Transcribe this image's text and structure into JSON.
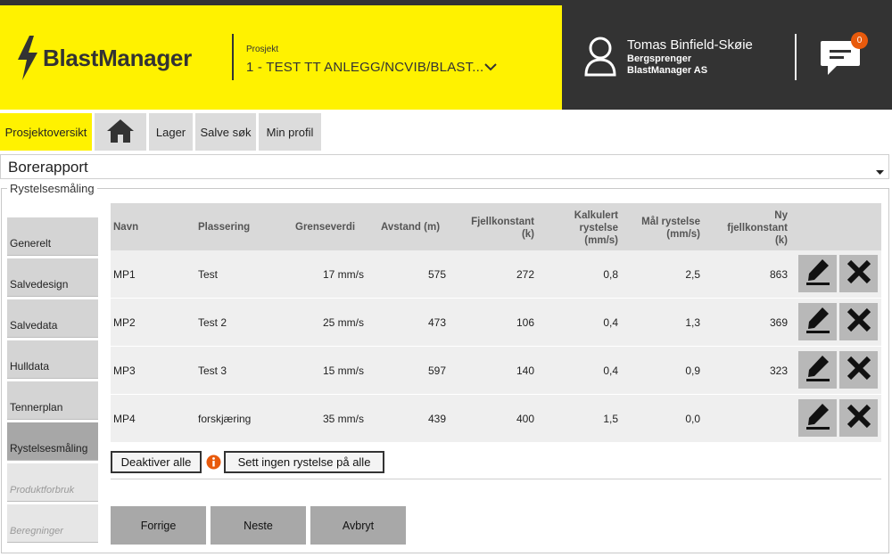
{
  "header": {
    "logo_text": "BlastManager",
    "project_label": "Prosjekt",
    "project_value": "1 - TEST TT ANLEGG/NCVIB/BLAST...",
    "user_name": "Tomas Binfield-Skøie",
    "user_role": "Bergsprenger",
    "user_company": "BlastManager AS",
    "notification_count": "0",
    "accent_yellow": "#fff200",
    "dark_bg": "#333333",
    "badge_color": "#e85a0c"
  },
  "nav": {
    "tabs": [
      {
        "label": "Prosjektoversikt",
        "active": true
      },
      {
        "label": "",
        "icon": "home-icon"
      },
      {
        "label": "Lager"
      },
      {
        "label": "Salve søk"
      },
      {
        "label": "Min profil"
      }
    ]
  },
  "report": {
    "title": "Borerapport"
  },
  "section": {
    "label": "Rystelsesmåling"
  },
  "sidebar": {
    "items": [
      {
        "label": "Generelt"
      },
      {
        "label": "Salvedesign"
      },
      {
        "label": "Salvedata"
      },
      {
        "label": "Hulldata"
      },
      {
        "label": "Tennerplan"
      },
      {
        "label": "Rystelsesmåling",
        "selected": true
      },
      {
        "label": "Produktforbruk",
        "disabled": true
      },
      {
        "label": "Beregninger",
        "disabled": true
      }
    ]
  },
  "table": {
    "headers": {
      "navn": "Navn",
      "plassering": "Plassering",
      "grenseverdi": "Grenseverdi",
      "avstand": "Avstand (m)",
      "fjellkonstant_1": "Fjellkonstant",
      "fjellkonstant_2": "(k)",
      "kalkulert_1": "Kalkulert",
      "kalkulert_2": "rystelse",
      "kalkulert_3": "(mm/s)",
      "maal_1": "Mål rystelse",
      "maal_2": "(mm/s)",
      "ny_1": "Ny",
      "ny_2": "fjellkonstant",
      "ny_3": "(k)"
    },
    "rows": [
      {
        "navn": "MP1",
        "plassering": "Test",
        "grenseverdi": "17 mm/s",
        "avstand": "575",
        "fjellkonstant": "272",
        "kalkulert": "0,8",
        "maal": "2,5",
        "ny": "863"
      },
      {
        "navn": "MP2",
        "plassering": "Test 2",
        "grenseverdi": "25 mm/s",
        "avstand": "473",
        "fjellkonstant": "106",
        "kalkulert": "0,4",
        "maal": "1,3",
        "ny": "369"
      },
      {
        "navn": "MP3",
        "plassering": "Test 3",
        "grenseverdi": "15 mm/s",
        "avstand": "597",
        "fjellkonstant": "140",
        "kalkulert": "0,4",
        "maal": "0,9",
        "ny": "323"
      },
      {
        "navn": "MP4",
        "plassering": "forskjæring",
        "grenseverdi": "35 mm/s",
        "avstand": "439",
        "fjellkonstant": "400",
        "kalkulert": "1,5",
        "maal": "0,0",
        "ny": ""
      }
    ]
  },
  "actions": {
    "deactivate_all": "Deaktiver alle",
    "set_no_vibration": "Sett ingen rystelse på alle"
  },
  "footer": {
    "prev": "Forrige",
    "next": "Neste",
    "cancel": "Avbryt"
  }
}
